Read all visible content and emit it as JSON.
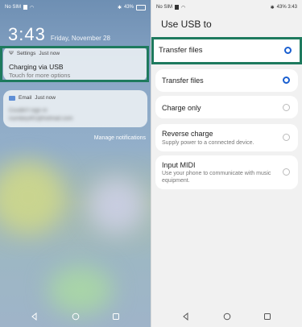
{
  "left": {
    "status_left": "No SIM",
    "status_right": "43%",
    "clock_time": "3:43",
    "clock_date": "Friday, November 28",
    "usb_notification": {
      "app": "Settings",
      "time": "Just now",
      "title": "Charging via USB",
      "subtitle": "Touch for more options"
    },
    "email_notification": {
      "app": "Email",
      "time": "Just now",
      "line1": "Couldn't sign in",
      "line2": "numbey4f1@hotmail.com"
    },
    "manage_label": "Manage notifications"
  },
  "right": {
    "status_left": "No SIM",
    "status_right": "43% 3:43",
    "heading": "Use USB to",
    "highlight_label": "Transfer files",
    "options": [
      {
        "label": "Transfer files",
        "desc": "",
        "selected": true
      },
      {
        "label": "Charge only",
        "desc": "",
        "selected": false
      },
      {
        "label": "Reverse charge",
        "desc": "Supply power to a connected device.",
        "selected": false
      },
      {
        "label": "Input MIDI",
        "desc": "Use your phone to communicate with music equipment.",
        "selected": false
      }
    ]
  },
  "colors": {
    "highlight": "#1e7a5e",
    "radio_selected": "#1a5fd0"
  },
  "icons": {
    "nav": [
      "back-icon",
      "home-icon",
      "recents-icon"
    ],
    "status": [
      "sim-icon",
      "wifi-icon",
      "bluetooth-icon",
      "vibrate-icon",
      "battery-icon"
    ]
  }
}
